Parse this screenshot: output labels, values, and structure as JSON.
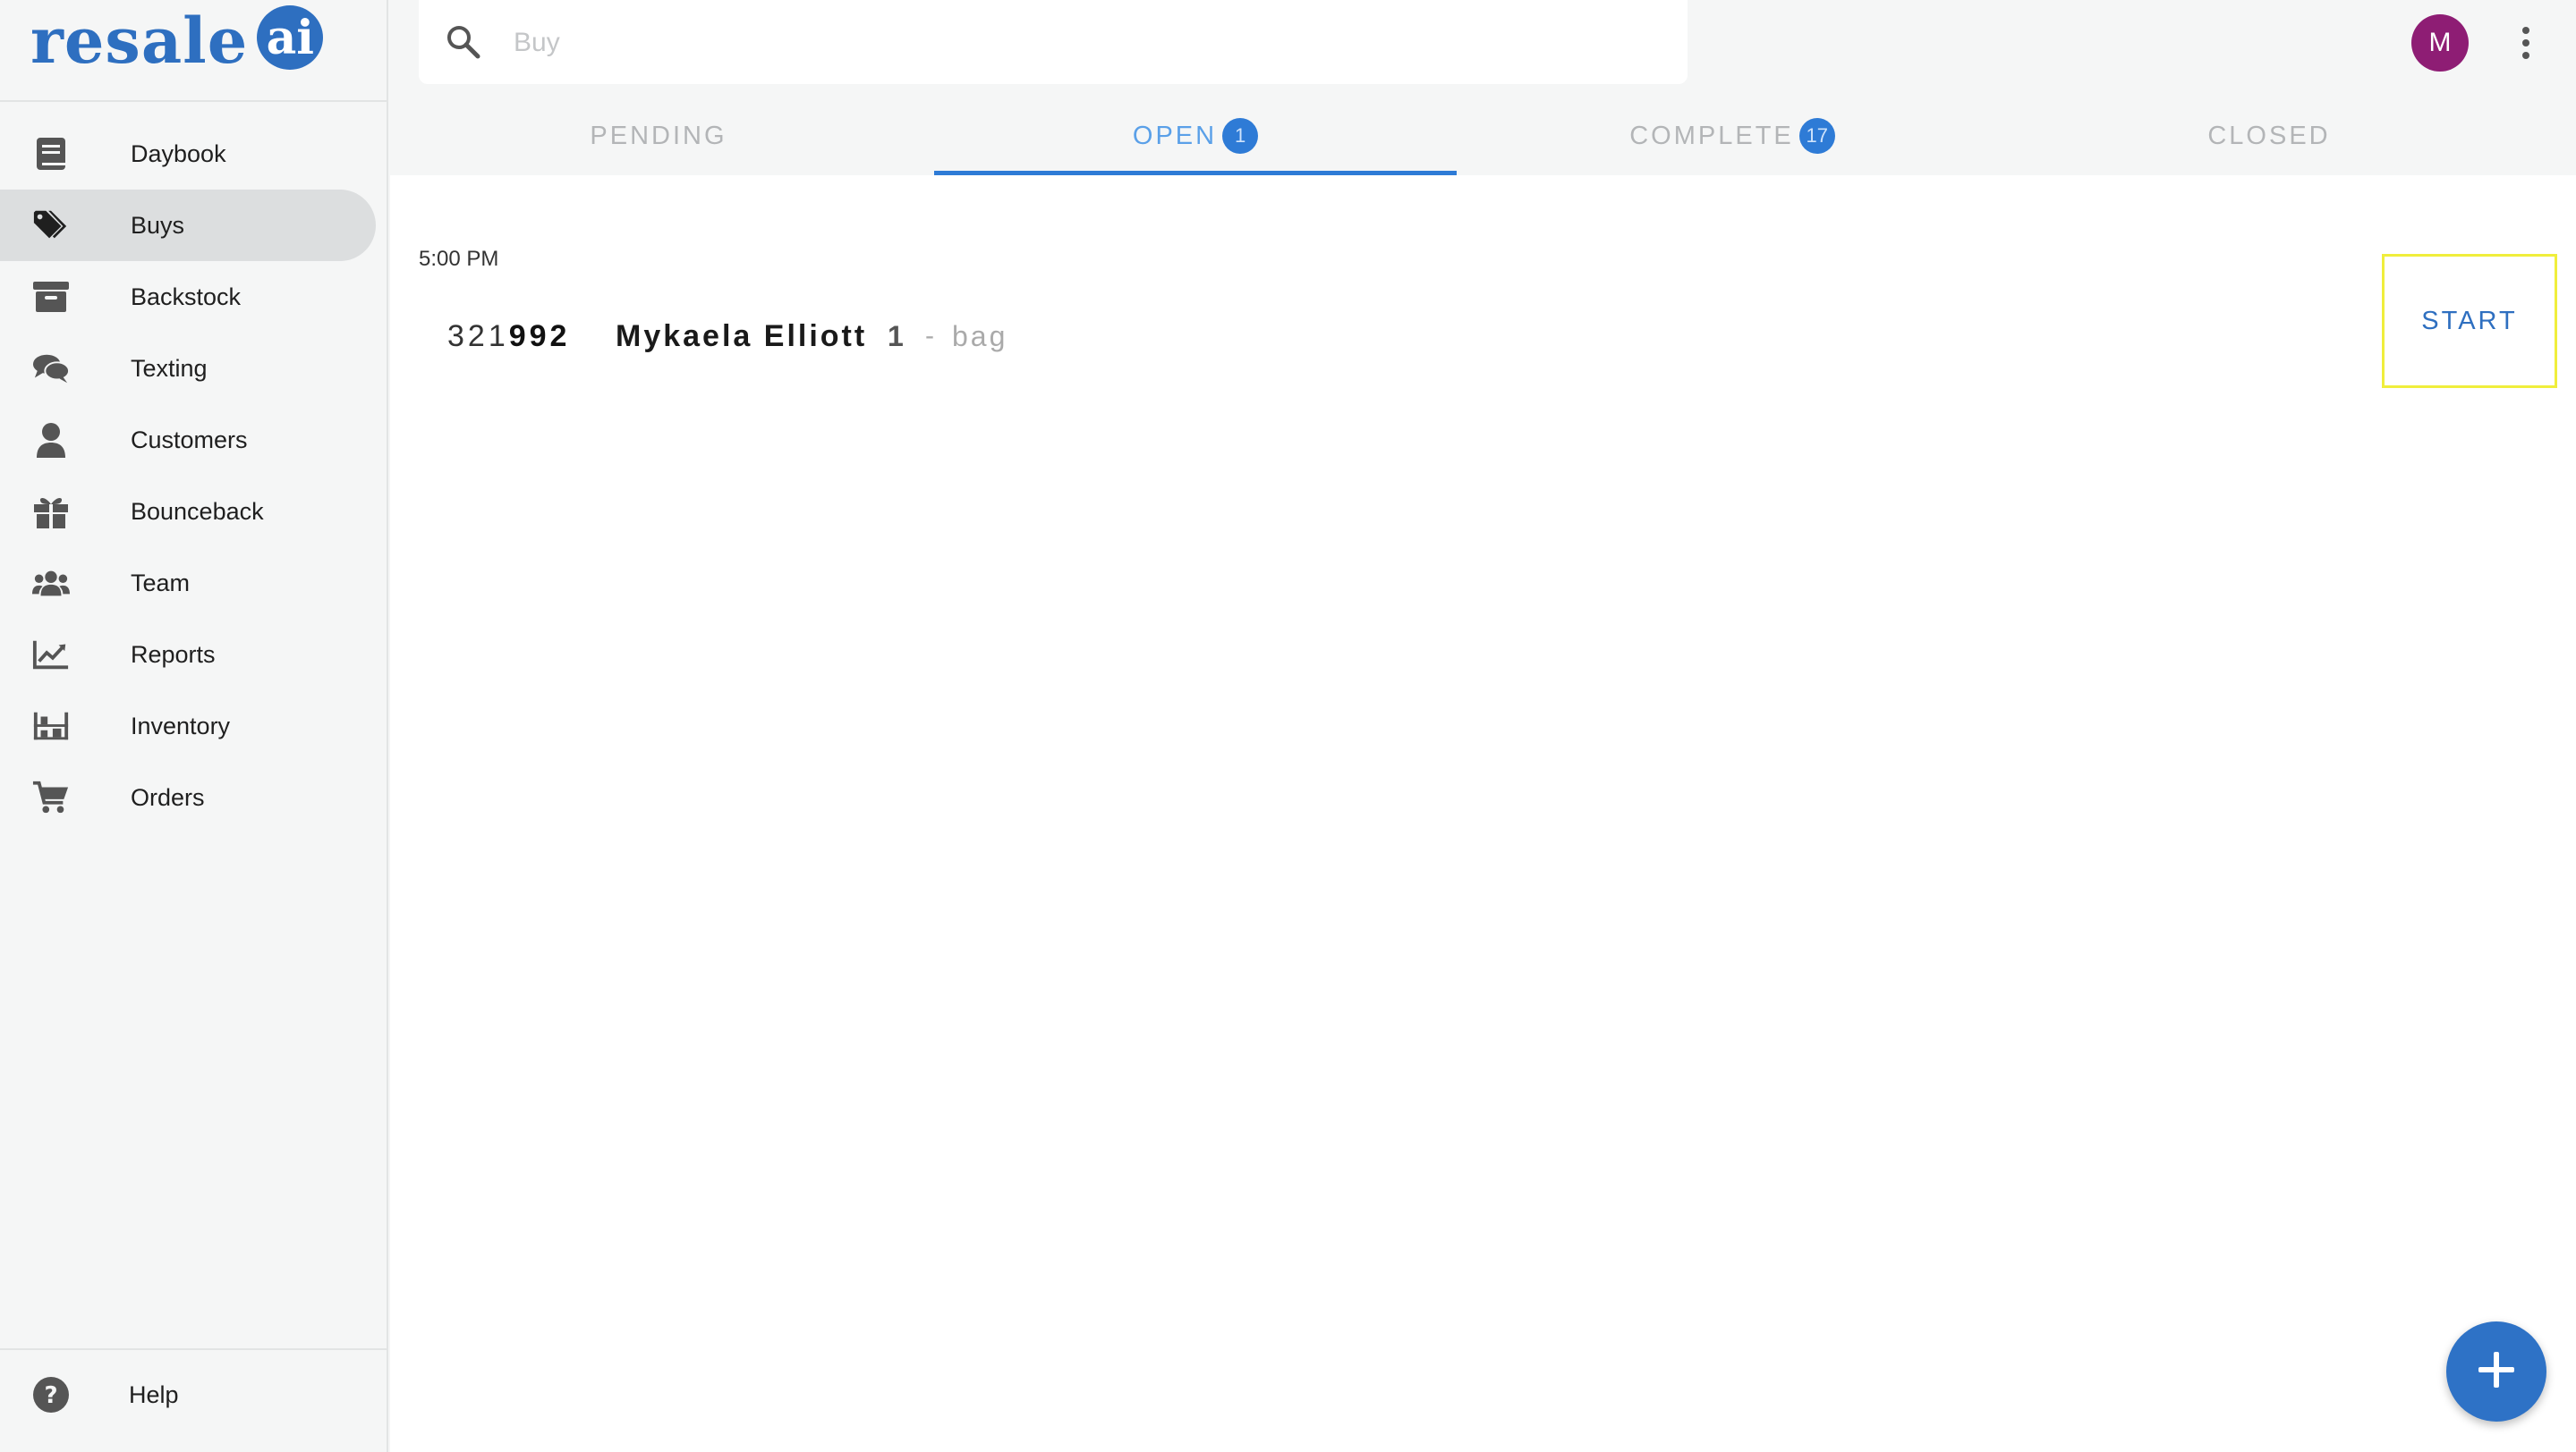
{
  "brand": {
    "logo_text": "resale",
    "logo_mark": "ai"
  },
  "sidebar": {
    "items": [
      {
        "label": "Daybook",
        "icon": "book-icon"
      },
      {
        "label": "Buys",
        "icon": "tags-icon",
        "active": true
      },
      {
        "label": "Backstock",
        "icon": "archive-box-icon"
      },
      {
        "label": "Texting",
        "icon": "chat-bubbles-icon"
      },
      {
        "label": "Customers",
        "icon": "person-icon"
      },
      {
        "label": "Bounceback",
        "icon": "gift-icon"
      },
      {
        "label": "Team",
        "icon": "people-group-icon"
      },
      {
        "label": "Reports",
        "icon": "chart-line-icon"
      },
      {
        "label": "Inventory",
        "icon": "shelves-icon"
      },
      {
        "label": "Orders",
        "icon": "cart-icon"
      }
    ],
    "help": {
      "label": "Help",
      "icon": "question-circle-icon"
    }
  },
  "search": {
    "placeholder": "Buy",
    "value": ""
  },
  "user": {
    "avatar_initial": "M",
    "avatar_color": "#8e1d74"
  },
  "tabs": [
    {
      "label": "PENDING",
      "badge": ""
    },
    {
      "label": "OPEN",
      "badge": "1",
      "active": true
    },
    {
      "label": "COMPLETE",
      "badge": "17"
    },
    {
      "label": "CLOSED",
      "badge": ""
    }
  ],
  "content": {
    "group_time": "5:00 PM",
    "buys": [
      {
        "id_prefix": "321",
        "id_suffix": "992",
        "customer": "Mykaela Elliott",
        "quantity": "1",
        "separator": "-",
        "unit": "bag",
        "action": "START"
      }
    ]
  },
  "colors": {
    "accent": "#2e72c6",
    "highlight_outline": "#f0ee3c"
  }
}
